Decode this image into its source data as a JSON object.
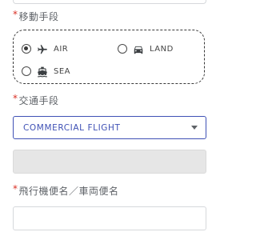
{
  "fields": {
    "transport_mode": {
      "required_mark": "*",
      "label": "移動手段",
      "options": [
        {
          "label": "AIR",
          "icon": "airplane-icon",
          "checked": true
        },
        {
          "label": "LAND",
          "icon": "car-icon",
          "checked": false
        },
        {
          "label": "SEA",
          "icon": "ship-icon",
          "checked": false
        }
      ]
    },
    "transport_means": {
      "required_mark": "*",
      "label": "交通手段",
      "selected": "COMMERCIAL FLIGHT"
    },
    "flight_number": {
      "required_mark": "*",
      "label": "飛行機便名／車両便名",
      "value": ""
    }
  },
  "colors": {
    "accent": "#3f51b5",
    "required": "#d93025",
    "disabled_bg": "#e6e6e6"
  }
}
